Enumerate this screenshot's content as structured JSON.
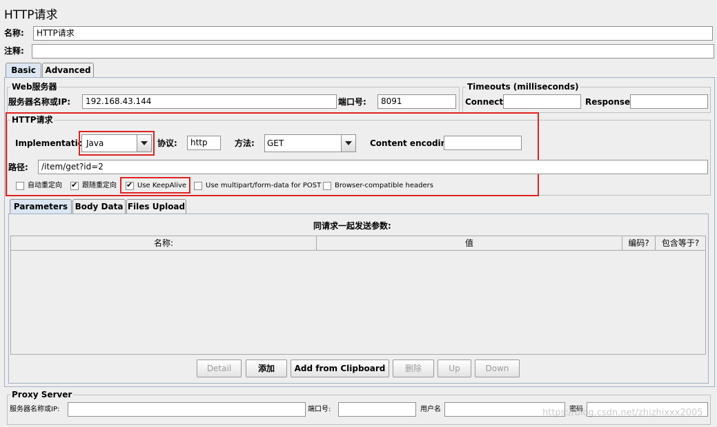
{
  "title": "HTTP请求",
  "name_label": "名称:",
  "name_value": "HTTP请求",
  "comment_label": "注释:",
  "comment_value": "",
  "tabs": [
    "Basic",
    "Advanced"
  ],
  "web_server": {
    "group_title": "Web服务器",
    "server_label": "服务器名称或IP:",
    "server_value": "192.168.43.144",
    "port_label": "端口号:",
    "port_value": "8091"
  },
  "timeouts": {
    "group_title": "Timeouts (milliseconds)",
    "connect_label": "Connect:",
    "connect_value": "",
    "response_label": "Response:",
    "response_value": ""
  },
  "http_request": {
    "group_title": "HTTP请求",
    "impl_label": "Implementation:",
    "impl_value": "Java",
    "protocol_label": "协议:",
    "protocol_value": "http",
    "method_label": "方法:",
    "method_value": "GET",
    "encoding_label": "Content encoding:",
    "encoding_value": "",
    "path_label": "路径:",
    "path_value": "/item/get?id=2",
    "checkboxes": [
      {
        "label": "自动重定向",
        "checked": false
      },
      {
        "label": "跟随重定向",
        "checked": true
      },
      {
        "label": "Use KeepAlive",
        "checked": true
      },
      {
        "label": "Use multipart/form-data for POST",
        "checked": false
      },
      {
        "label": "Browser-compatible headers",
        "checked": false
      }
    ]
  },
  "param_tabs": [
    "Parameters",
    "Body Data",
    "Files Upload"
  ],
  "params_caption": "同请求一起发送参数:",
  "params_columns": [
    "名称:",
    "值",
    "编码?",
    "包含等于?"
  ],
  "buttons": [
    "Detail",
    "添加",
    "Add from Clipboard",
    "删除",
    "Up",
    "Down"
  ],
  "proxy": {
    "group_title": "Proxy Server",
    "server_label": "服务器名称或IP:",
    "port_label": "端口号:",
    "user_label": "用户名",
    "password_label": "密码"
  },
  "watermark": "https://blog.csdn.net/zhizhixxx2005",
  "colors": {
    "highlight": "#e02020",
    "tab_active": "#dbe6f1"
  }
}
